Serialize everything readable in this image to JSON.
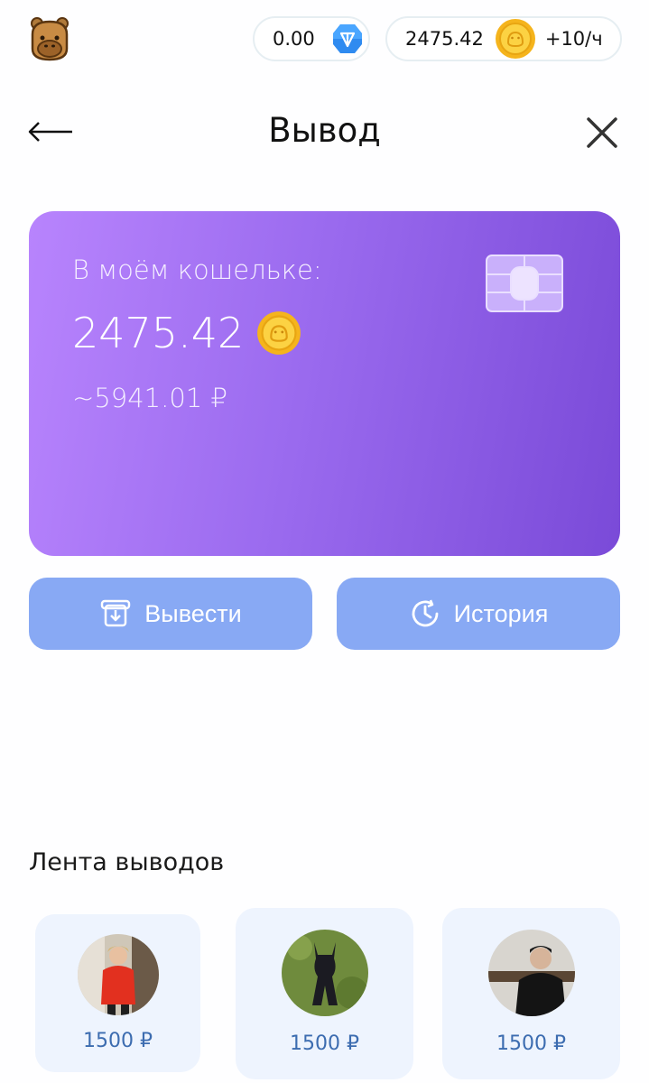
{
  "topbar": {
    "logo_icon": "capybara-logo-icon",
    "ton_balance": "0.00",
    "ton_icon": "ton-diamond-icon",
    "coin_balance": "2475.42",
    "coin_icon": "gold-coin-icon",
    "coin_rate": "+10/ч"
  },
  "header": {
    "back_icon": "arrow-left-icon",
    "title": "Вывод",
    "close_icon": "close-icon"
  },
  "wallet_card": {
    "label": "В моём кошельке:",
    "amount": "2475.42",
    "coin_icon": "gold-coin-icon",
    "rub_equivalent": "~5941.01 ₽",
    "chip_icon": "card-chip-icon",
    "gradient_start": "#b884fd",
    "gradient_end": "#7a4ad8"
  },
  "actions": {
    "withdraw_label": "Вывести",
    "withdraw_icon": "withdraw-tray-icon",
    "history_label": "История",
    "history_icon": "history-clock-icon",
    "button_color": "#88a9f4"
  },
  "feed": {
    "title": "Лента выводов",
    "items": [
      {
        "avatar": "user-avatar-person-red-jacket",
        "amount": "1500 ₽"
      },
      {
        "avatar": "user-avatar-black-dog",
        "amount": "1500 ₽"
      },
      {
        "avatar": "user-avatar-person-black-hoodie",
        "amount": "1500 ₽"
      }
    ]
  }
}
